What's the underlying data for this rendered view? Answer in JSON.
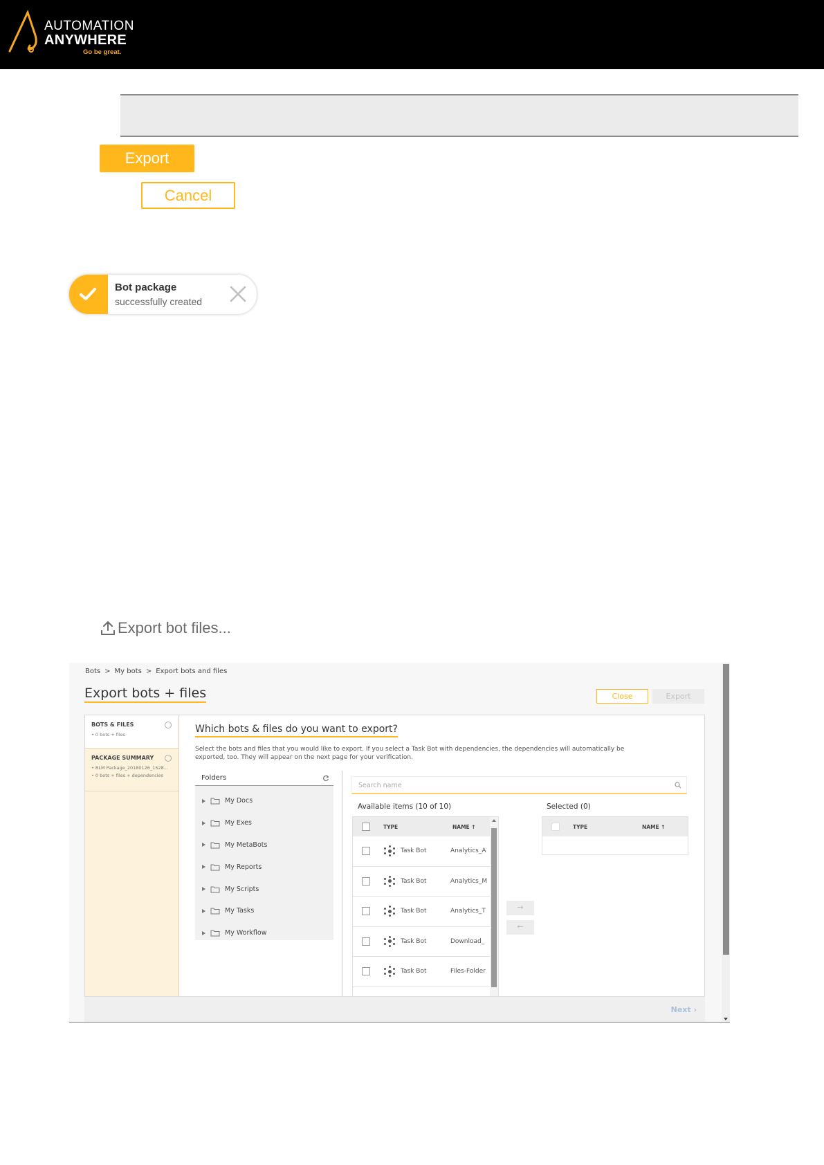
{
  "header": {
    "logo_line1": "AUTOMATION",
    "logo_line2": "ANYWHERE",
    "logo_tagline": "Go be great.",
    "brand_color": "#ffb71b"
  },
  "buttons": {
    "export_label": "Export",
    "cancel_label": "Cancel"
  },
  "toast": {
    "title": "Bot package",
    "message": "successfully created",
    "icon": "check-icon",
    "close_icon": "close-icon"
  },
  "export_link": {
    "label": "Export bot files...",
    "icon": "upload-icon"
  },
  "screen": {
    "breadcrumb": [
      "Bots",
      ">",
      "My bots",
      ">",
      "Export bots and files"
    ],
    "title": "Export bots + files",
    "close_label": "Close",
    "export_label": "Export",
    "steps": [
      {
        "title": "BOTS & FILES",
        "sub": "• 0 bots + files"
      },
      {
        "title": "PACKAGE SUMMARY",
        "sub1": "• BLM Package_20180126_1528...",
        "sub2": "• 0 bots + files + dependencies"
      }
    ],
    "question": "Which bots & files do you want to export?",
    "description": "Select the bots and files that you would like to export. If you select a Task Bot with dependencies, the dependencies will automatically be exported, too. They will appear on the next page for your verification.",
    "folders_label": "Folders",
    "folders": [
      "My Docs",
      "My Exes",
      "My MetaBots",
      "My Reports",
      "My Scripts",
      "My Tasks",
      "My Workflow"
    ],
    "search_placeholder": "Search name",
    "available_label": "Available items  (10 of 10)",
    "selected_label": "Selected  (0)",
    "columns": {
      "type": "TYPE",
      "name": "NAME ↑"
    },
    "items": [
      {
        "type": "Task Bot",
        "name": "Analytics_A"
      },
      {
        "type": "Task Bot",
        "name": "Analytics_M"
      },
      {
        "type": "Task Bot",
        "name": "Analytics_T"
      },
      {
        "type": "Task Bot",
        "name": "Download_"
      },
      {
        "type": "Task Bot",
        "name": "Files-Folder"
      }
    ],
    "move_right": "→",
    "move_left": "←",
    "next_label": "Next ›"
  }
}
